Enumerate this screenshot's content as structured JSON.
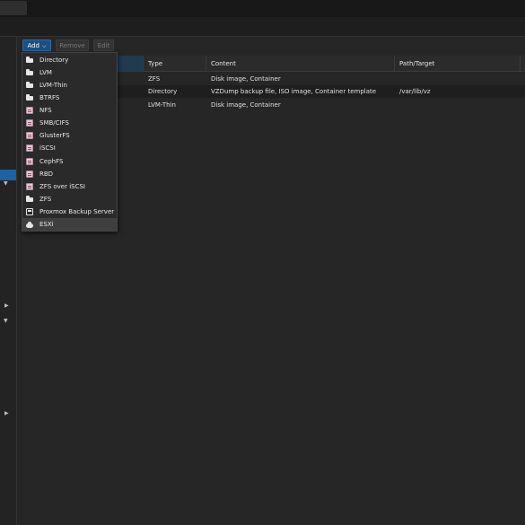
{
  "toolbar": {
    "add_label": "Add",
    "add_chevron": "⌵",
    "remove_label": "Remove",
    "edit_label": "Edit"
  },
  "grid": {
    "columns": [
      "",
      "Type",
      "Content",
      "Path/Target"
    ],
    "rows": [
      {
        "type": "ZFS",
        "content": "Disk image, Container",
        "path": ""
      },
      {
        "type": "Directory",
        "content": "VZDump backup file, ISO image, Container template",
        "path": "/var/lib/vz"
      },
      {
        "type": "LVM-Thin",
        "content": "Disk image, Container",
        "path": ""
      }
    ]
  },
  "add_menu": {
    "items": [
      {
        "label": "Directory",
        "icon": "folder-icon"
      },
      {
        "label": "LVM",
        "icon": "folder-icon"
      },
      {
        "label": "LVM-Thin",
        "icon": "folder-icon"
      },
      {
        "label": "BTRFS",
        "icon": "folder-icon"
      },
      {
        "label": "NFS",
        "icon": "database-icon"
      },
      {
        "label": "SMB/CIFS",
        "icon": "database-icon"
      },
      {
        "label": "GlusterFS",
        "icon": "database-icon"
      },
      {
        "label": "iSCSI",
        "icon": "database-icon"
      },
      {
        "label": "CephFS",
        "icon": "database-icon"
      },
      {
        "label": "RBD",
        "icon": "database-icon"
      },
      {
        "label": "ZFS over iSCSI",
        "icon": "database-icon"
      },
      {
        "label": "ZFS",
        "icon": "folder-icon"
      },
      {
        "label": "Proxmox Backup Server",
        "icon": "floppy-icon"
      },
      {
        "label": "ESXi",
        "icon": "cloud-icon"
      }
    ],
    "active_item": "ESXi"
  },
  "sidebar": {
    "arrows": [
      "▼",
      "▶",
      "▼",
      "▶"
    ]
  },
  "colors": {
    "accent": "#1b62a6",
    "background": "#262626"
  }
}
